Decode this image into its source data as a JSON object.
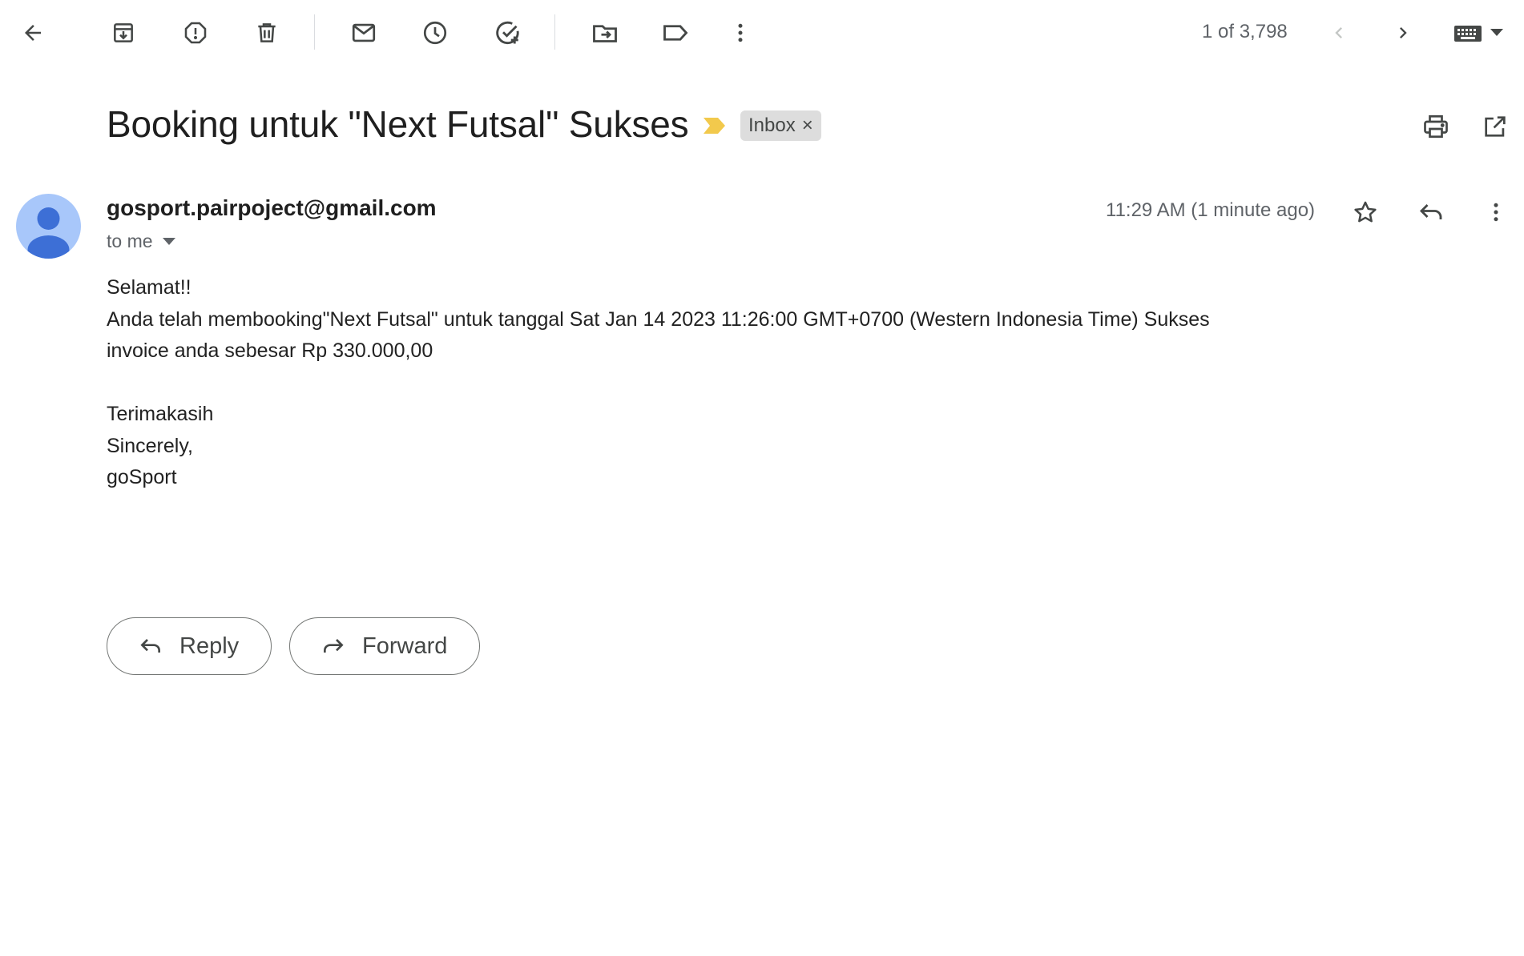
{
  "toolbar": {
    "icons": [
      "back-icon",
      "archive-icon",
      "report-spam-icon",
      "delete-icon",
      "mark-unread-icon",
      "snooze-icon",
      "add-task-icon",
      "move-to-icon",
      "label-icon",
      "more-vert-icon"
    ],
    "pager_text": "1 of 3,798",
    "input_tools_icon": "keyboard-icon"
  },
  "email": {
    "subject": "Booking untuk \"Next Futsal\" Sukses",
    "label": "Inbox",
    "label_remove": "×",
    "sender": "gosport.pairpoject@gmail.com",
    "recipient": "to me",
    "date": "11:29 AM (1 minute ago)",
    "body": {
      "line1": "Selamat!!",
      "line2": "Anda telah membooking\"Next Futsal\" untuk tanggal Sat Jan 14 2023 11:26:00 GMT+0700 (Western Indonesia Time) Sukses",
      "line3": "invoice anda sebesar Rp 330.000,00",
      "line4": "Terimakasih",
      "line5": "Sincerely,",
      "line6": "goSport"
    }
  },
  "actions": {
    "reply_label": "Reply",
    "forward_label": "Forward"
  },
  "colors": {
    "importance_marker": "#f2c94c",
    "avatar_bg": "#a8c7fa",
    "avatar_fg": "#3d6fd6",
    "label_chip_bg": "#dddddd"
  }
}
